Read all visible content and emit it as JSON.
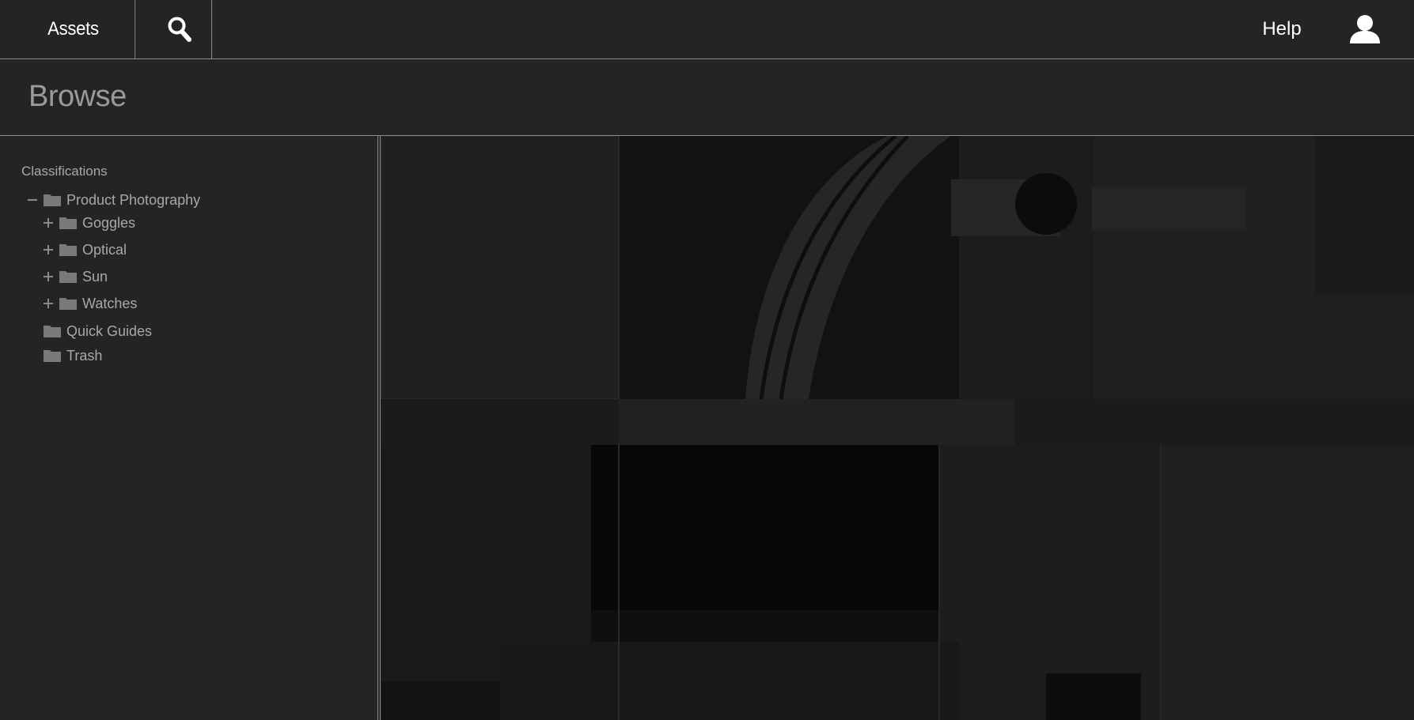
{
  "topbar": {
    "assets_label": "Assets",
    "search_icon": "search-icon",
    "help_label": "Help",
    "user_icon": "user-icon"
  },
  "page": {
    "title": "Browse"
  },
  "tree": {
    "heading": "Classifications",
    "items": [
      {
        "label": "Product Photography",
        "toggle": "minus",
        "level": 0
      },
      {
        "label": "Goggles",
        "toggle": "plus",
        "level": 1
      },
      {
        "label": "Optical",
        "toggle": "plus",
        "level": 1
      },
      {
        "label": "Sun",
        "toggle": "plus",
        "level": 1
      },
      {
        "label": "Watches",
        "toggle": "plus",
        "level": 1
      },
      {
        "label": "Quick Guides",
        "toggle": "none",
        "level": 0
      },
      {
        "label": "Trash",
        "toggle": "none",
        "level": 0
      }
    ]
  },
  "colors": {
    "background": "#242424",
    "divider": "#8a8a8a",
    "text_primary": "#ffffff",
    "text_muted": "#a8a8a8",
    "folder": "#7a7a7a",
    "preview_bg": "#151515"
  }
}
